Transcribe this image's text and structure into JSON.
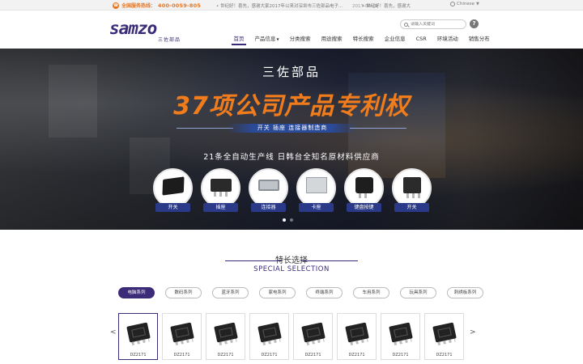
{
  "topbar": {
    "hotline_label": "全国服务热线：",
    "hotline_number": "400-0059-805",
    "news1": "• 世纪好！喜先，感谢大家2017年以来对深圳市三佐部品电子...",
    "news1_date": "2017-06-14",
    "news2": "• 世纪好！喜先，感谢大",
    "language": "Chinese"
  },
  "header": {
    "logo_text": "samzo",
    "logo_sub": "三佐部品",
    "search_placeholder": "请输入关键词",
    "help": "?",
    "nav": [
      {
        "label": "首页",
        "active": true
      },
      {
        "label": "产品信息",
        "caret": "▼"
      },
      {
        "label": "分类搜索"
      },
      {
        "label": "用途搜索"
      },
      {
        "label": "特长搜索"
      },
      {
        "label": "企业信息"
      },
      {
        "label": "CSR"
      },
      {
        "label": "环境活动"
      },
      {
        "label": "销售分布"
      }
    ]
  },
  "banner": {
    "brand": "三佐部品",
    "headline": "37项公司产品专利权",
    "ribbon": "开关 插座 连接器制造商",
    "subline": "21条全自动生产线 日韩台全知名原材料供应商",
    "products": [
      "开关",
      "插座",
      "连接器",
      "卡座",
      "键盘按键",
      "开关"
    ],
    "slides_total": 2,
    "slide_active": 1
  },
  "section": {
    "title": "特长选择",
    "subtitle": "SPECIAL SELECTION",
    "tabs": [
      "电脑系列",
      "数码系列",
      "蓝牙系列",
      "家电系列",
      "终端系列",
      "车用系列",
      "玩具系列",
      "刺绣板系列"
    ],
    "active_tab": 0,
    "items": [
      "DZ2171",
      "DZ2171",
      "DZ2171",
      "DZ2171",
      "DZ2171",
      "DZ2171",
      "DZ2171",
      "DZ2171"
    ],
    "prev": "<",
    "next": ">"
  }
}
